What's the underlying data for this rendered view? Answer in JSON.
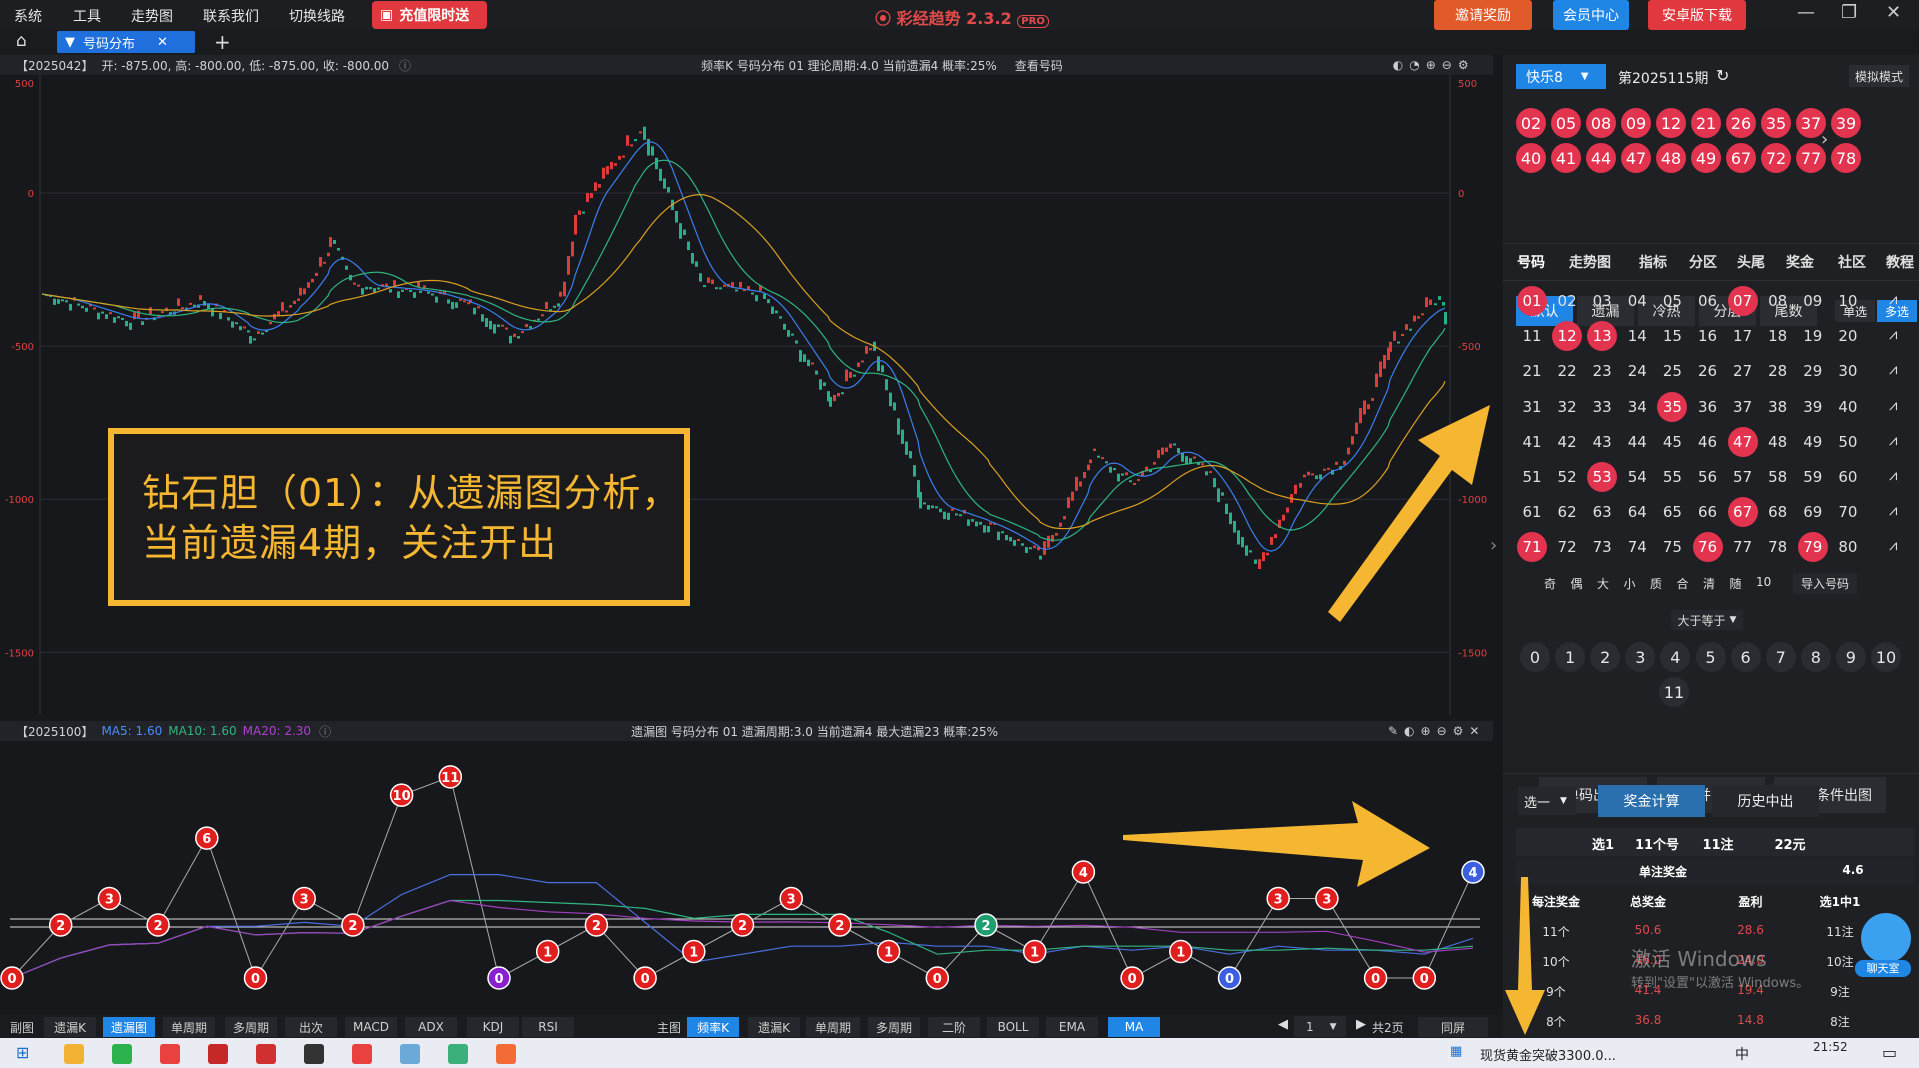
{
  "menu": [
    "系统",
    "工具",
    "走势图",
    "联系我们",
    "切换线路"
  ],
  "promo": "充值限时送",
  "app_title": "彩经趋势 2.3.2",
  "app_badge": "PRO",
  "invite": "邀请奖励",
  "member": "会员中心",
  "android": "安卓版下载",
  "tab": "号码分布",
  "main_chart": {
    "period": "【2025042】",
    "ohlc": "开: -875.00, 高: -800.00, 低: -875.00, 收: -800.00",
    "info": "频率K  号码分布  01    理论周期:4.0  当前遗漏4  概率:25%",
    "link": "查看号码",
    "yticks": [
      "500",
      "0",
      "-500",
      "-1000",
      "-1500"
    ]
  },
  "callout": {
    "line1": "钻石胆（01）：从遗漏图分析，",
    "line2": "当前遗漏4期，关注开出"
  },
  "sub_chart": {
    "period": "【2025100】",
    "ma5": "MA5: 1.60",
    "ma10": "MA10: 1.60",
    "ma20": "MA20: 2.30",
    "info": "遗漏图  号码分布  01    遗漏周期:3.0  当前遗漏4  最大遗漏23  概率:25%",
    "points": [
      "0",
      "2",
      "3",
      "2",
      "6",
      "0",
      "3",
      "2",
      "10",
      "11",
      "0",
      "1",
      "2",
      "0",
      "1",
      "2",
      "3",
      "2",
      "1",
      "0",
      "2",
      "1",
      "4",
      "0",
      "1",
      "0",
      "3",
      "3",
      "0",
      "0",
      "4"
    ]
  },
  "bottom_left": [
    "副图",
    "遗漏K",
    "遗漏图",
    "单周期",
    "多周期",
    "出次",
    "MACD",
    "ADX",
    "KDJ",
    "RSI"
  ],
  "bottom_right": [
    "主图",
    "频率K",
    "遗漏K",
    "单周期",
    "多周期",
    "二阶",
    "BOLL",
    "EMA",
    "MA"
  ],
  "pager": {
    "page": "1",
    "total": "共2页",
    "sync": "同屏"
  },
  "sidebar": {
    "lottery": "快乐8",
    "issue": "第2025115期",
    "mode": "模拟模式",
    "draw_row1": [
      "02",
      "05",
      "08",
      "09",
      "12",
      "21",
      "26",
      "35",
      "37",
      "39"
    ],
    "draw_row2": [
      "40",
      "41",
      "44",
      "47",
      "48",
      "49",
      "67",
      "72",
      "77",
      "78"
    ],
    "nav": [
      "号码",
      "走势图",
      "指标",
      "分区",
      "头尾",
      "奖金",
      "社区",
      "教程"
    ],
    "filters": [
      "默认",
      "遗漏",
      "冷热",
      "分层",
      "尾数"
    ],
    "single": "单选",
    "multi": "多选",
    "numbers": [
      "01",
      "02",
      "03",
      "04",
      "05",
      "06",
      "07",
      "08",
      "09",
      "10",
      "11",
      "12",
      "13",
      "14",
      "15",
      "16",
      "17",
      "18",
      "19",
      "20",
      "21",
      "22",
      "23",
      "24",
      "25",
      "26",
      "27",
      "28",
      "29",
      "30",
      "31",
      "32",
      "33",
      "34",
      "35",
      "36",
      "37",
      "38",
      "39",
      "40",
      "41",
      "42",
      "43",
      "44",
      "45",
      "46",
      "47",
      "48",
      "49",
      "50",
      "51",
      "52",
      "53",
      "54",
      "55",
      "56",
      "57",
      "58",
      "59",
      "60",
      "61",
      "62",
      "63",
      "64",
      "65",
      "66",
      "67",
      "68",
      "69",
      "70",
      "71",
      "72",
      "73",
      "74",
      "75",
      "76",
      "77",
      "78",
      "79",
      "80"
    ],
    "selected": [
      "01",
      "07",
      "12",
      "13",
      "35",
      "47",
      "53",
      "67",
      "71",
      "76",
      "79"
    ],
    "quick": [
      "奇",
      "偶",
      "大",
      "小",
      "质",
      "合",
      "清",
      "随",
      "10",
      "导入号码"
    ],
    "ge_label": "大于等于",
    "digits": [
      "0",
      "1",
      "2",
      "3",
      "4",
      "5",
      "6",
      "7",
      "8",
      "9",
      "10",
      "11"
    ],
    "actions": [
      "单码出图",
      "合并出图",
      "选中条件出图"
    ],
    "choose": "选一",
    "calc": "奖金计算",
    "history": "历史中出",
    "summary": [
      "选1",
      "11个号",
      "11注",
      "22元"
    ],
    "single_prize_label": "单注奖金",
    "single_prize": "4.6",
    "headers": [
      "每注奖金",
      "总奖金",
      "盈利",
      "选1中1"
    ],
    "rows": [
      [
        "11个",
        "50.6",
        "28.6",
        "11注"
      ],
      [
        "10个",
        "46.0",
        "24.0",
        "10注"
      ],
      [
        "9个",
        "41.4",
        "19.4",
        "9注"
      ],
      [
        "8个",
        "36.8",
        "14.8",
        "8注"
      ]
    ],
    "watermark1": "激活 Windows",
    "watermark2": "转到\"设置\"以激活 Windows。",
    "chat": "聊天室"
  },
  "taskbar": {
    "news": "现货黄金突破3300.0...",
    "time": "21:52",
    "ime": "中"
  }
}
